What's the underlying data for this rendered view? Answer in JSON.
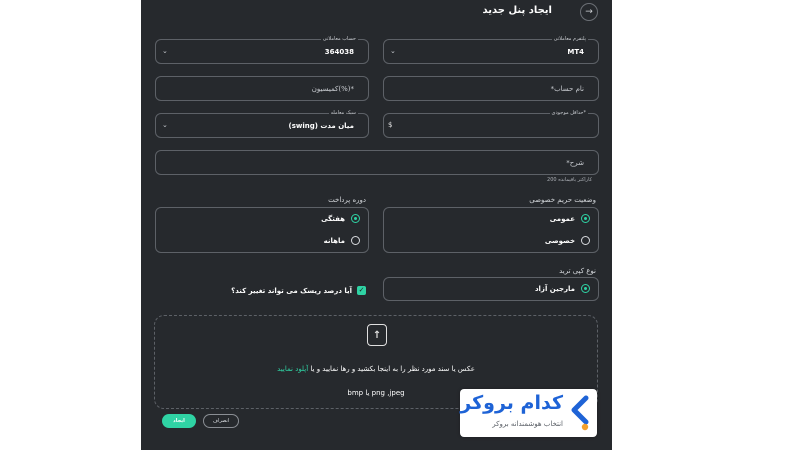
{
  "header": {
    "title": "ایجاد پنل جدید",
    "back_icon": "arrow-right-icon"
  },
  "form": {
    "platform": {
      "label": "پلتفرم معاملاتی",
      "value": "MT4"
    },
    "trading_account": {
      "label": "حساب معاملاتی",
      "value": "364038"
    },
    "account_name": {
      "placeholder": "نام حساب*"
    },
    "commission": {
      "placeholder": "*(%)کمیسیون"
    },
    "min_balance": {
      "label": "*حداقل موجودی",
      "currency": "$"
    },
    "trading_style": {
      "label": "سبک معامله",
      "value": "میان مدت (swing)"
    },
    "description": {
      "placeholder": "شرح*",
      "counter": "200 کاراکتر باقیمانده"
    }
  },
  "privacy": {
    "label": "وضعیت حریم خصوصی",
    "options": [
      {
        "label": "عمومی",
        "selected": true
      },
      {
        "label": "خصوصی",
        "selected": false
      }
    ]
  },
  "payment_period": {
    "label": "دوره پرداخت",
    "options": [
      {
        "label": "هفتگی",
        "selected": true
      },
      {
        "label": "ماهانه",
        "selected": false
      }
    ]
  },
  "copy_type": {
    "label": "نوع کپی ترید",
    "options": [
      {
        "label": "مارجین آزاد",
        "selected": true
      }
    ]
  },
  "risk_checkbox": {
    "label": "آیا درصد ریسک می تواند تغییر کند؟",
    "checked": true
  },
  "upload": {
    "icon": "file-upload-icon",
    "text": "عکس یا سند مورد نظر را به اینجا بکشید و رها نمایید و یا",
    "link": "آپلود نمایید",
    "formats": "png ,jpeg یا bmp"
  },
  "buttons": {
    "create": "ایجاد",
    "cancel": "انصراف"
  },
  "watermark": {
    "title": "کدام بروکر",
    "subtitle": "انتخاب هوشمندانه بروکر"
  },
  "colors": {
    "panel_bg": "#26292d",
    "accent": "#2fd3a4",
    "border": "#5d6167",
    "brand_blue": "#1e63d6",
    "brand_orange": "#f4a02a"
  }
}
